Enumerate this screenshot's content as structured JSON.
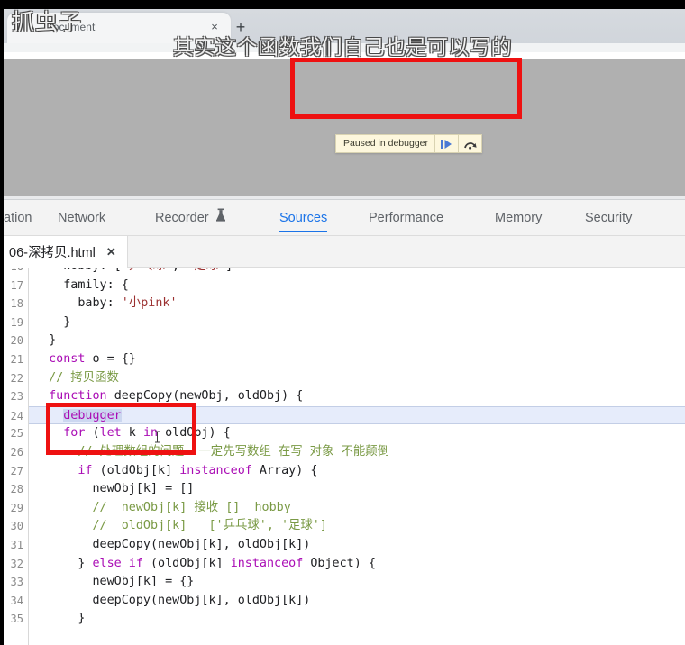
{
  "overlay": {
    "watermark": "抓虫子",
    "subtitle": "其实这个函数我们自己也是可以写的"
  },
  "browser": {
    "tab_title": "Document",
    "tab_close_label": "×",
    "new_tab_label": "+"
  },
  "debugger_pill": {
    "label": "Paused in debugger",
    "resume_icon": "resume-script-icon",
    "step_over_icon": "step-over-icon"
  },
  "devtools": {
    "tabs": [
      {
        "label": "ation",
        "active": false,
        "icon": null
      },
      {
        "label": "Network",
        "active": false,
        "icon": null
      },
      {
        "label": "Recorder",
        "active": false,
        "icon": "flask-icon"
      },
      {
        "label": "Sources",
        "active": true,
        "icon": null
      },
      {
        "label": "Performance",
        "active": false,
        "icon": null
      },
      {
        "label": "Memory",
        "active": false,
        "icon": null
      },
      {
        "label": "Security",
        "active": false,
        "icon": null
      }
    ],
    "file_tab": {
      "name": "06-深拷贝.html",
      "close_label": "✕"
    }
  },
  "editor": {
    "accent_highlight": "#e6ecfb",
    "annotation_color": "#ee1111",
    "lines": [
      {
        "no": "16",
        "partial_top": true,
        "tokens": [
          {
            "t": "plain",
            "s": "    hobby: ["
          },
          {
            "t": "str",
            "s": "'乒乓球'"
          },
          {
            "t": "plain",
            "s": ", "
          },
          {
            "t": "str",
            "s": "'足球'"
          },
          {
            "t": "plain",
            "s": "]"
          }
        ]
      },
      {
        "no": "17",
        "tokens": [
          {
            "t": "plain",
            "s": "    family: {"
          }
        ]
      },
      {
        "no": "18",
        "tokens": [
          {
            "t": "plain",
            "s": "      baby: "
          },
          {
            "t": "str",
            "s": "'小pink'"
          }
        ]
      },
      {
        "no": "19",
        "tokens": [
          {
            "t": "plain",
            "s": "    }"
          }
        ]
      },
      {
        "no": "20",
        "tokens": [
          {
            "t": "plain",
            "s": "  }"
          }
        ]
      },
      {
        "no": "21",
        "tokens": [
          {
            "t": "kw",
            "s": "  const"
          },
          {
            "t": "plain",
            "s": " o = {}"
          }
        ]
      },
      {
        "no": "22",
        "tokens": [
          {
            "t": "com",
            "s": "  // 拷贝函数"
          }
        ]
      },
      {
        "no": "23",
        "tokens": [
          {
            "t": "kw",
            "s": "  function"
          },
          {
            "t": "plain",
            "s": " "
          },
          {
            "t": "fn",
            "s": "deepCopy"
          },
          {
            "t": "plain",
            "s": "(newObj, oldObj) {"
          }
        ]
      },
      {
        "no": "24",
        "highlight": true,
        "tokens": [
          {
            "t": "plain",
            "s": "    "
          },
          {
            "t": "sel",
            "s": "debugger"
          }
        ]
      },
      {
        "no": "25",
        "tokens": [
          {
            "t": "kw",
            "s": "    for"
          },
          {
            "t": "plain",
            "s": " ("
          },
          {
            "t": "kw",
            "s": "let"
          },
          {
            "t": "plain",
            "s": " k "
          },
          {
            "t": "kw",
            "s": "in"
          },
          {
            "t": "plain",
            "s": " oldObj) {"
          }
        ]
      },
      {
        "no": "26",
        "tokens": [
          {
            "t": "com",
            "s": "      // 处理数组的问题  一定先写数组 在写 对象 不能颠倒"
          }
        ]
      },
      {
        "no": "27",
        "tokens": [
          {
            "t": "kw",
            "s": "      if"
          },
          {
            "t": "plain",
            "s": " (oldObj[k] "
          },
          {
            "t": "kw",
            "s": "instanceof"
          },
          {
            "t": "plain",
            "s": " Array) {"
          }
        ]
      },
      {
        "no": "28",
        "tokens": [
          {
            "t": "plain",
            "s": "        newObj[k] = []"
          }
        ]
      },
      {
        "no": "29",
        "tokens": [
          {
            "t": "com",
            "s": "        //  newObj[k] 接收 []  hobby"
          }
        ]
      },
      {
        "no": "30",
        "tokens": [
          {
            "t": "com",
            "s": "        //  oldObj[k]   ['乒乓球', '足球']"
          }
        ]
      },
      {
        "no": "31",
        "tokens": [
          {
            "t": "plain",
            "s": "        deepCopy(newObj[k], oldObj[k])"
          }
        ]
      },
      {
        "no": "32",
        "tokens": [
          {
            "t": "plain",
            "s": "      } "
          },
          {
            "t": "kw",
            "s": "else if"
          },
          {
            "t": "plain",
            "s": " (oldObj[k] "
          },
          {
            "t": "kw",
            "s": "instanceof"
          },
          {
            "t": "plain",
            "s": " Object) {"
          }
        ]
      },
      {
        "no": "33",
        "tokens": [
          {
            "t": "plain",
            "s": "        newObj[k] = {}"
          }
        ]
      },
      {
        "no": "34",
        "tokens": [
          {
            "t": "plain",
            "s": "        deepCopy(newObj[k], oldObj[k])"
          }
        ]
      },
      {
        "no": "35",
        "tokens": [
          {
            "t": "plain",
            "s": "      }"
          }
        ]
      }
    ]
  }
}
